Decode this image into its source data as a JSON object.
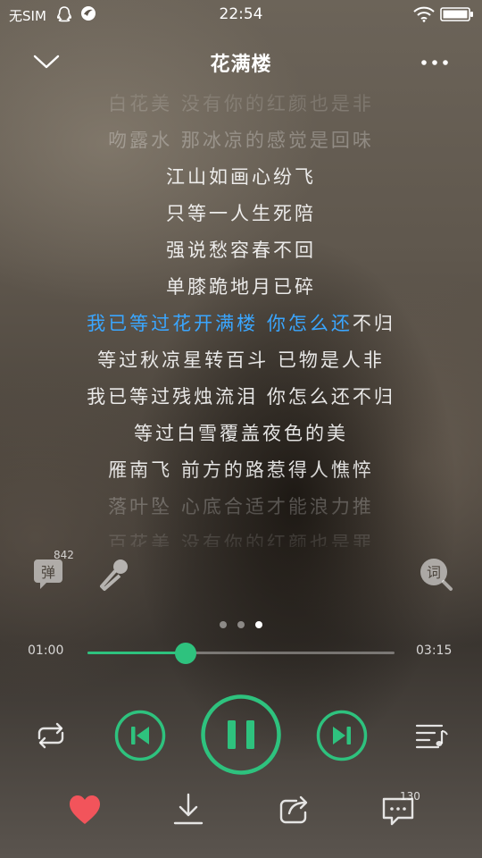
{
  "status_bar": {
    "carrier": "无SIM",
    "time": "22:54"
  },
  "header": {
    "title": "花满楼"
  },
  "lyrics": {
    "lines": [
      "白花美 没有你的红颜也是非",
      "吻露水 那冰凉的感觉是回味",
      "江山如画心纷飞",
      "只等一人生死陪",
      "强说愁容春不回",
      "单膝跪地月已碎",
      "我已等过花开满楼 你怎么还不归",
      "等过秋凉星转百斗 已物是人非",
      "我已等过残烛流泪 你怎么还不归",
      "等过白雪覆盖夜色的美",
      "雁南飞 前方的路惹得人憔悴",
      "落叶坠 心底合适才能浪力推",
      "百花美 没有你的红颜也是罪"
    ],
    "current_line_index": 6,
    "current_sung": "我已等过花开满楼 你怎么还",
    "current_rest": "不归"
  },
  "side_icons": {
    "danmu_label": "弹",
    "danmu_count": "842",
    "lyric_label": "词"
  },
  "pager": {
    "count": 3,
    "active": 2
  },
  "progress": {
    "current": "01:00",
    "total": "03:15",
    "fraction": 0.32
  },
  "controls": {
    "state": "playing"
  },
  "actions": {
    "comment_count": "130"
  },
  "colors": {
    "accent": "#2ec27e",
    "lyric_highlight": "#3aa6ff",
    "like": "#f2545b"
  },
  "icons": [
    "qq-icon",
    "browser-icon",
    "wifi-icon",
    "battery-icon",
    "chevron-down-icon",
    "more-icon",
    "danmu-icon",
    "mic-icon",
    "lyric-search-icon",
    "repeat-icon",
    "prev-icon",
    "pause-icon",
    "next-icon",
    "playlist-icon",
    "heart-icon",
    "download-icon",
    "share-icon",
    "comment-icon"
  ]
}
